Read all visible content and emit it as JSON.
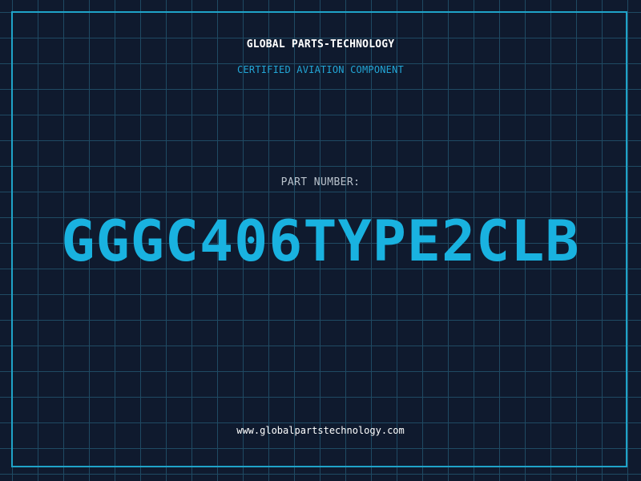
{
  "header": {
    "company": "GLOBAL PARTS-TECHNOLOGY",
    "tagline": "CERTIFIED AVIATION COMPONENT"
  },
  "part": {
    "label": "PART NUMBER:",
    "number": "GGGC406TYPE2CLB"
  },
  "footer": {
    "website": "www.globalpartstechnology.com"
  },
  "colors": {
    "background": "#0f1a2e",
    "grid": "#1f4a63",
    "accent": "#19b2e0",
    "text": "#ffffff"
  }
}
